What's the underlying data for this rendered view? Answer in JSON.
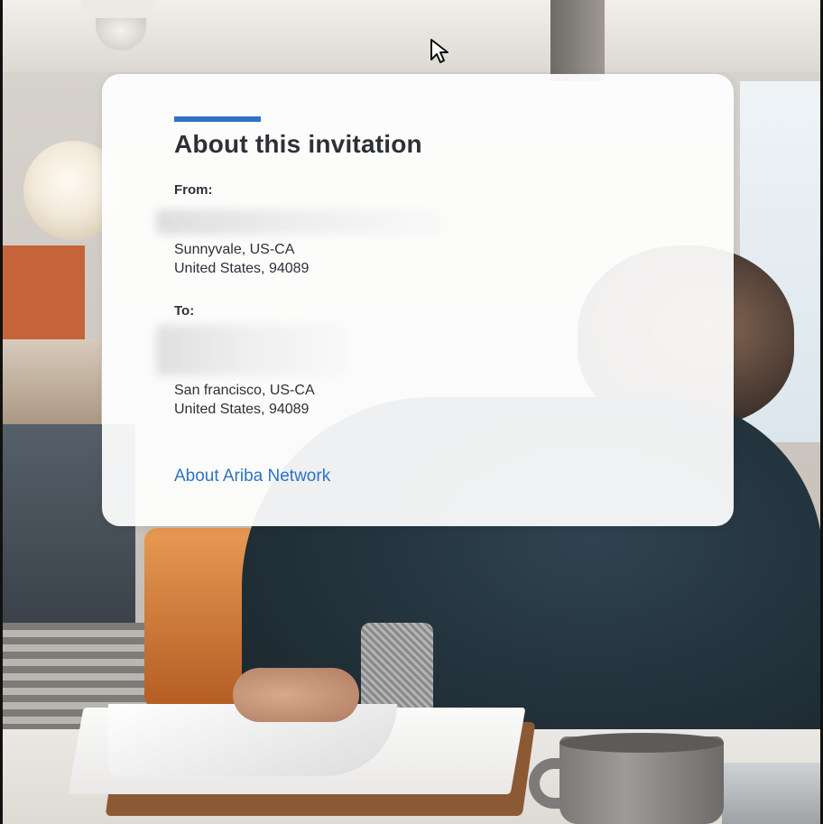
{
  "invitation": {
    "title": "About this invitation",
    "from_label": "From:",
    "from_city": "Sunnyvale, US-CA",
    "from_country": "United States, 94089",
    "to_label": "To:",
    "to_city": "San francisco, US-CA",
    "to_country": "United States, 94089",
    "about_link": "About Ariba Network"
  },
  "colors": {
    "accent": "#2f73c4",
    "text": "#2c3138",
    "card_background": "#ffffff"
  },
  "icons": {
    "cursor": "mouse-pointer-icon"
  }
}
